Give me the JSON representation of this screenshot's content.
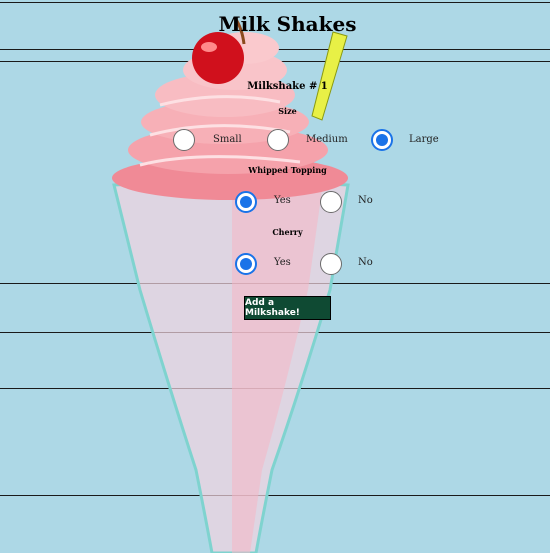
{
  "page": {
    "title": "Milk Shakes"
  },
  "form": {
    "heading": "Milkshake # 1",
    "size": {
      "label": "Size",
      "options": [
        "Small",
        "Medium",
        "Large"
      ],
      "selected": "Large"
    },
    "whipped_topping": {
      "label": "Whipped Topping",
      "options": [
        "Yes",
        "No"
      ],
      "selected": "Yes"
    },
    "cherry": {
      "label": "Cherry",
      "options": [
        "Yes",
        "No"
      ],
      "selected": "Yes"
    },
    "submit_label": "Add a Milkshake!"
  },
  "colors": {
    "background": "#add8e6",
    "radio_accent": "#1a73e8",
    "button": "#0f4a33"
  }
}
